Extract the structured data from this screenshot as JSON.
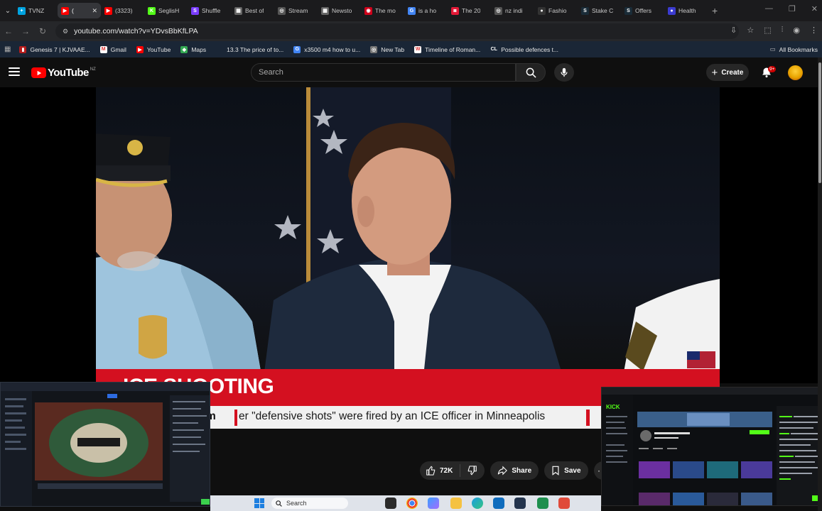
{
  "browser": {
    "tabs": [
      {
        "label": "TVNZ",
        "color": "#00a3e0",
        "glyph": "+"
      },
      {
        "label": "(",
        "color": "#ff0000",
        "glyph": "▶",
        "active": true
      },
      {
        "label": "(3323)",
        "color": "#ff0000",
        "glyph": "▶"
      },
      {
        "label": "SeglisH",
        "color": "#53fc18",
        "glyph": "K"
      },
      {
        "label": "Shuffle",
        "color": "#7a3cff",
        "glyph": "S"
      },
      {
        "label": "Best of",
        "color": "#666666",
        "glyph": "▦"
      },
      {
        "label": "Stream",
        "color": "#555555",
        "glyph": "◎"
      },
      {
        "label": "Newsto",
        "color": "#666666",
        "glyph": "▦"
      },
      {
        "label": "The mo",
        "color": "#d0021b",
        "glyph": "◉"
      },
      {
        "label": "is a ho",
        "color": "#4285f4",
        "glyph": "G"
      },
      {
        "label": "The 20",
        "color": "#e31937",
        "glyph": "◙"
      },
      {
        "label": "nz indi",
        "color": "#555555",
        "glyph": "◎"
      },
      {
        "label": "Fashio",
        "color": "#333333",
        "glyph": "●"
      },
      {
        "label": "Stake C",
        "color": "#1a2c38",
        "glyph": "S"
      },
      {
        "label": "Offers",
        "color": "#1a2c38",
        "glyph": "S"
      },
      {
        "label": "Health",
        "color": "#3b3bd0",
        "glyph": "●"
      }
    ],
    "url": "youtube.com/watch?v=YDvsBbKfLPA",
    "bookmarks": [
      {
        "label": "Genesis 7 | KJVAAE...",
        "color": "#b51c1c",
        "glyph": "▮"
      },
      {
        "label": "Gmail",
        "color": "#ffffff",
        "glyph": "M"
      },
      {
        "label": "YouTube",
        "color": "#ff0000",
        "glyph": "▶"
      },
      {
        "label": "Maps",
        "color": "#34a853",
        "glyph": "◆"
      },
      {
        "label": "13.3 The price of to...",
        "color": "#1a2636",
        "glyph": ""
      },
      {
        "label": "x3500 m4 how to u...",
        "color": "#4285f4",
        "glyph": "G"
      },
      {
        "label": "New Tab",
        "color": "#777777",
        "glyph": "◎"
      },
      {
        "label": "Timeline of Roman...",
        "color": "#ffffff",
        "glyph": "W"
      },
      {
        "label": "Possible defences t...",
        "color": "#1a2636",
        "glyph": "CL"
      }
    ],
    "all_bookmarks": "All Bookmarks"
  },
  "youtube": {
    "logo_text": "YouTube",
    "country": "NZ",
    "search_placeholder": "Search",
    "create_label": "Create",
    "notif_badge": "9+"
  },
  "video": {
    "lower_third_kicker": "ICE SHOOTING",
    "lower_third_left": "m",
    "lower_third_text": "er \"defensive shots\" were fired by an ICE officer in Minneapolis"
  },
  "actions": {
    "like_count": "72K",
    "share_label": "Share",
    "save_label": "Save"
  },
  "taskbar": {
    "search_placeholder": "Search"
  }
}
